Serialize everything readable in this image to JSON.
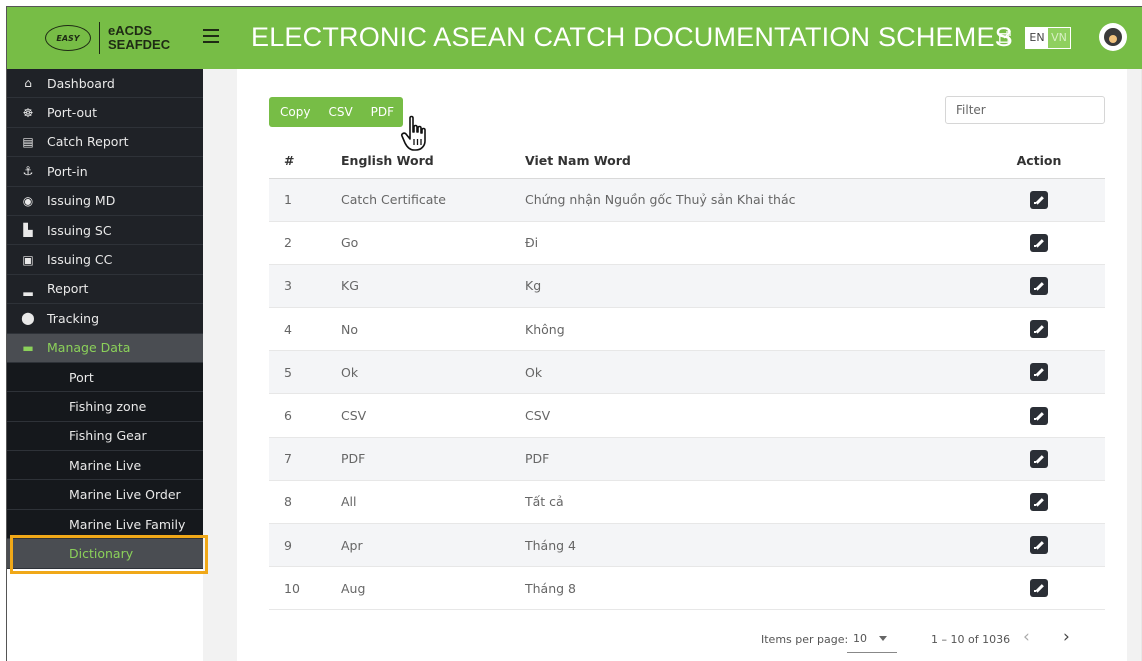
{
  "header": {
    "logo_mark": "EASY",
    "logo_line1": "eACDS",
    "logo_line2": "SEAFDEC",
    "title": "ELECTRONIC ASEAN CATCH DOCUMENTATION SCHEMES",
    "lang_en": "EN",
    "lang_vn": "VN",
    "accent_color": "#77bd46"
  },
  "sidebar": {
    "items": [
      {
        "label": "Dashboard",
        "icon": "home-icon",
        "glyph": "⌂"
      },
      {
        "label": "Port-out",
        "icon": "ship-wheel-icon",
        "glyph": "☸"
      },
      {
        "label": "Catch Report",
        "icon": "document-icon",
        "glyph": "▤"
      },
      {
        "label": "Port-in",
        "icon": "anchor-icon",
        "glyph": "⚓"
      },
      {
        "label": "Issuing MD",
        "icon": "coin-icon",
        "glyph": "◉"
      },
      {
        "label": "Issuing SC",
        "icon": "factory-icon",
        "glyph": "▙"
      },
      {
        "label": "Issuing CC",
        "icon": "cc-icon",
        "glyph": "▣"
      },
      {
        "label": "Report",
        "icon": "bar-chart-icon",
        "glyph": "▂"
      },
      {
        "label": "Tracking",
        "icon": "map-marker-icon",
        "glyph": "⬤"
      },
      {
        "label": "Manage Data",
        "icon": "folder-icon",
        "glyph": "▬"
      }
    ],
    "sub_items": [
      "Port",
      "Fishing zone",
      "Fishing Gear",
      "Marine Live",
      "Marine Live Order",
      "Marine Live Family",
      "Dictionary"
    ]
  },
  "toolbar": {
    "copy_label": "Copy",
    "csv_label": "CSV",
    "pdf_label": "PDF",
    "filter_placeholder": "Filter"
  },
  "table": {
    "headers": [
      "#",
      "English Word",
      "Viet Nam Word",
      "Action"
    ],
    "rows": [
      {
        "num": "1",
        "en": "Catch Certificate",
        "vn": "Chứng nhận Nguồn gốc Thuỷ sản Khai thác"
      },
      {
        "num": "2",
        "en": "Go",
        "vn": "Đi"
      },
      {
        "num": "3",
        "en": "KG",
        "vn": "Kg"
      },
      {
        "num": "4",
        "en": "No",
        "vn": "Không"
      },
      {
        "num": "5",
        "en": "Ok",
        "vn": "Ok"
      },
      {
        "num": "6",
        "en": "CSV",
        "vn": "CSV"
      },
      {
        "num": "7",
        "en": "PDF",
        "vn": "PDF"
      },
      {
        "num": "8",
        "en": "All",
        "vn": "Tất cả"
      },
      {
        "num": "9",
        "en": "Apr",
        "vn": "Tháng 4"
      },
      {
        "num": "10",
        "en": "Aug",
        "vn": "Tháng 8"
      }
    ]
  },
  "pagination": {
    "items_per_page_label": "Items per page:",
    "items_per_page_value": "10",
    "range": "1 – 10 of 1036",
    "prev": "‹",
    "next": "›"
  }
}
